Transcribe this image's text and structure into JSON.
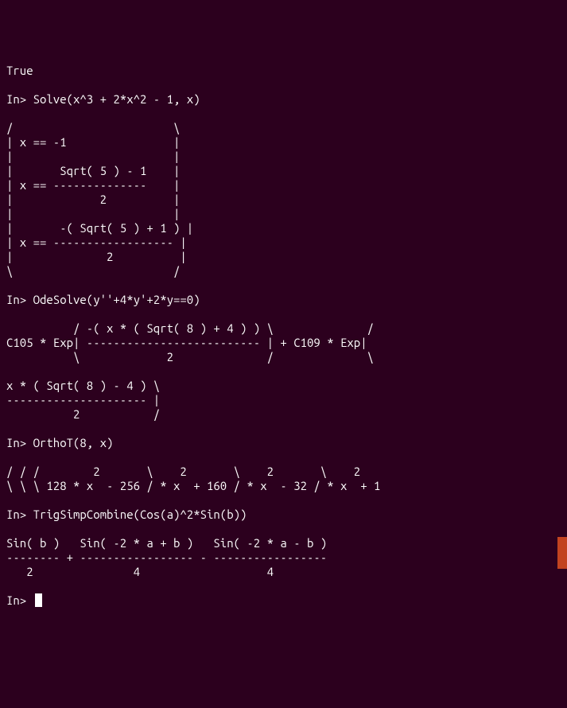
{
  "terminal": {
    "result_true": "True",
    "prompt": "In>",
    "commands": {
      "solve": "Solve(x^3 + 2*x^2 - 1, x)",
      "odesolve": "OdeSolve(y''+4*y'+2*y==0)",
      "orthot": "OrthoT(8, x)",
      "trigsimp": "TrigSimpCombine(Cos(a)^2*Sin(b))"
    },
    "outputs": {
      "solve_output": "/                        \\\n| x == -1                |\n|                        |\n|       Sqrt( 5 ) - 1    |\n| x == --------------    |\n|             2          |\n|                        |\n|       -( Sqrt( 5 ) + 1 ) |\n| x == ------------------ |\n|              2          |\n\\                        /",
      "odesolve_output": "          / -( x * ( Sqrt( 8 ) + 4 ) ) \\              /\nC105 * Exp| -------------------------- | + C109 * Exp|\n          \\             2              /              \\\n\nx * ( Sqrt( 8 ) - 4 ) \\\n--------------------- |\n          2           /",
      "orthot_output": "/ / /        2       \\    2       \\    2       \\    2\n\\ \\ \\ 128 * x  - 256 / * x  + 160 / * x  - 32 / * x  + 1",
      "trigsimp_output": "Sin( b )   Sin( -2 * a + b )   Sin( -2 * a - b )\n-------- + ----------------- - -----------------\n   2               4                   4"
    }
  }
}
